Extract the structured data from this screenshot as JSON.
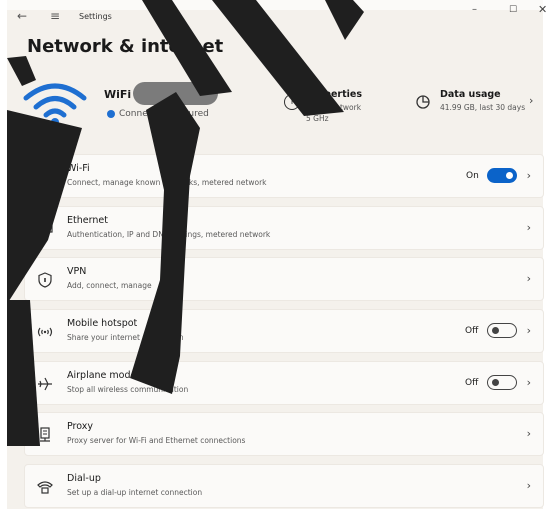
{
  "window": {
    "title": "Settings",
    "back_glyph": "←",
    "menu_glyph": "≡",
    "minimize_glyph": "–",
    "maximize_glyph": "☐",
    "close_glyph": "✕"
  },
  "page": {
    "title": "Network & internet"
  },
  "header": {
    "wifi_icon": "wifi-signal-icon",
    "ssid_label": "WiFi",
    "connection_status": "Connected, secured",
    "properties": {
      "icon": "info-icon",
      "title": "Properties",
      "line1": "Public network",
      "line2": "5 GHz"
    },
    "data_usage": {
      "icon": "pie-chart-icon",
      "title": "Data usage",
      "detail": "41.99 GB, last 30 days"
    },
    "chevron": "›"
  },
  "rows": [
    {
      "icon": "wifi-icon",
      "title": "Wi-Fi",
      "subtitle": "Connect, manage known networks, metered network",
      "state": "On",
      "toggle": true,
      "chevron": "›"
    },
    {
      "icon": "ethernet-icon",
      "title": "Ethernet",
      "subtitle": "Authentication, IP and DNS settings, metered network",
      "chevron": "›"
    },
    {
      "icon": "shield-icon",
      "title": "VPN",
      "subtitle": "Add, connect, manage",
      "chevron": "›"
    },
    {
      "icon": "hotspot-icon",
      "title": "Mobile hotspot",
      "subtitle": "Share your internet connection",
      "state": "Off",
      "toggle": false,
      "chevron": "›"
    },
    {
      "icon": "airplane-icon",
      "title": "Airplane mode",
      "subtitle": "Stop all wireless communication",
      "state": "Off",
      "toggle": false,
      "chevron": "›"
    },
    {
      "icon": "proxy-icon",
      "title": "Proxy",
      "subtitle": "Proxy server for Wi-Fi and Ethernet connections",
      "chevron": "›"
    },
    {
      "icon": "dial-up-icon",
      "title": "Dial-up",
      "subtitle": "Set up a dial-up internet connection",
      "chevron": "›"
    }
  ],
  "colors": {
    "accent": "#0b63c9",
    "background": "#f4f1ec",
    "card": "#fbfaf8",
    "marker": "#1f1f1f"
  }
}
